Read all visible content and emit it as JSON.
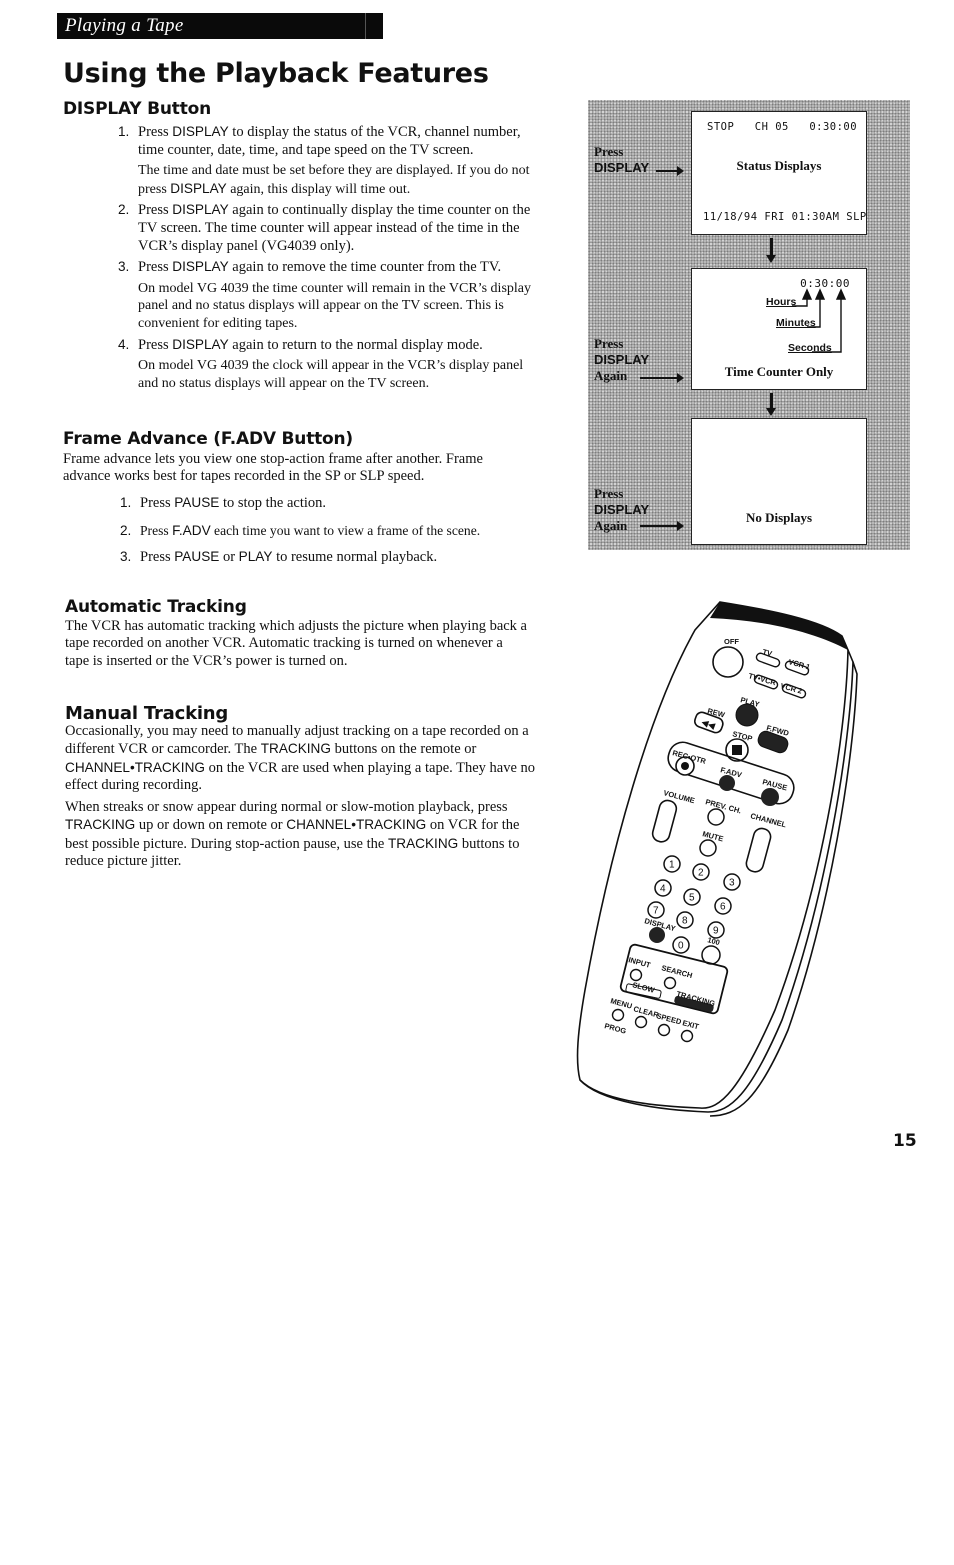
{
  "header": {
    "section_tab": "Playing a Tape"
  },
  "page": {
    "title": "Using the Playback Features",
    "page_number": "15"
  },
  "display_button": {
    "heading": "DISPLAY Button",
    "steps": [
      {
        "num": "1.",
        "pre": "Press ",
        "kw": "DISPLAY",
        "post": " to display the status of the VCR, channel number, time counter, date, time, and tape speed on the TV screen.",
        "note_pre": "The time and date must be set before they are displayed.  If you do not press ",
        "note_kw": "DISPLAY",
        "note_post": " again, this display will time out."
      },
      {
        "num": "2.",
        "pre": "Press ",
        "kw": "DISPLAY",
        "post": " again to continually display the time counter on the TV screen.  The time counter will appear instead of the time in the VCR’s display panel (VG4039 only).",
        "note_pre": "",
        "note_kw": "",
        "note_post": ""
      },
      {
        "num": "3.",
        "pre": "Press ",
        "kw": "DISPLAY",
        "post": " again to remove the time counter from the TV.",
        "note_pre": "On model VG 4039 the time counter will remain in the VCR’s display panel and no status displays will appear on the TV screen.  This is convenient for editing tapes.",
        "note_kw": "",
        "note_post": ""
      },
      {
        "num": "4.",
        "pre": "Press ",
        "kw": "DISPLAY",
        "post": " again to return to the normal display mode.",
        "note_pre": "On model VG 4039 the clock will appear in the VCR’s display panel and no status displays will appear on the TV screen.",
        "note_kw": "",
        "note_post": ""
      }
    ]
  },
  "frame_advance": {
    "heading": "Frame Advance (F.ADV Button)",
    "intro": "Frame advance lets you view one stop-action frame after another.  Frame advance works best for tapes recorded in the SP or SLP speed.",
    "steps": [
      {
        "num": "1.",
        "pre": "Press ",
        "kw": "PAUSE",
        "post": " to stop the action."
      },
      {
        "num": "2.",
        "pre": "Press ",
        "kw": "F.ADV",
        "post": " each time you want to view a frame of the scene."
      },
      {
        "num": "3.",
        "pre": "Press ",
        "kw": "PAUSE",
        "mid": "  or ",
        "kw2": "PLAY",
        "post": " to resume normal playback."
      }
    ]
  },
  "automatic_tracking": {
    "heading": "Automatic Tracking",
    "body": "The VCR has automatic tracking which adjusts the picture when playing back a tape recorded on another VCR.  Automatic tracking is turned on whenever a tape is inserted or the VCR’s power is turned on."
  },
  "manual_tracking": {
    "heading": "Manual Tracking",
    "p1_a": "Occasionally, you may need to manually adjust tracking on a tape recorded on a different VCR or camcorder.  The ",
    "p1_kw1": "TRACKING",
    "p1_b": " buttons on the remote or ",
    "p1_kw2": "CHANNEL•TRACKING",
    "p1_c": " on the VCR are used when playing a tape.  They have no effect during recording.",
    "p2_a": "When streaks or snow appear during normal or slow-motion playback, press ",
    "p2_kw1": "TRACKING",
    "p2_b": " up or down on remote or ",
    "p2_kw2": "CHANNEL•TRACKING",
    "p2_c": " on VCR for the best possible picture.  During stop-action pause, use the ",
    "p2_kw3": "TRACKING",
    "p2_d": " buttons to reduce picture jitter."
  },
  "diagram": {
    "screens": [
      {
        "top_line": "STOP   CH 05   0:30:00",
        "caption": "Status Displays",
        "bottom_line": "11/18/94 FRI 01:30AM SLP",
        "press_line1": "Press",
        "press_line2": "DISPLAY",
        "press_line3": ""
      },
      {
        "counter": "0:30:00",
        "labels": [
          "Hours",
          "Minutes",
          "Seconds"
        ],
        "caption": "Time Counter Only",
        "press_line1": "Press",
        "press_line2": "DISPLAY",
        "press_line3": "Again"
      },
      {
        "caption": "No Displays",
        "press_line1": "Press",
        "press_line2": "DISPLAY",
        "press_line3": "Again"
      }
    ]
  },
  "remote": {
    "labels": {
      "off": "OFF",
      "tv": "TV",
      "vcr1": "VCR 1",
      "tvvcr": "TV•VCR",
      "vcr2": "VCR 2",
      "play": "PLAY",
      "rew": "REW",
      "ffwd": "F.FWD",
      "stop": "STOP",
      "recotr": "REC•OTR",
      "fadv": "F.ADV",
      "pause": "PAUSE",
      "volume": "VOLUME",
      "prevch": "PREV. CH.",
      "channel": "CHANNEL",
      "mute": "MUTE",
      "display": "DISPLAY",
      "hundred": "100",
      "input": "INPUT",
      "search": "SEARCH",
      "slow": "SLOW",
      "tracking": "TRACKING",
      "menu": "MENU",
      "prog": "PROG",
      "clear": "CLEAR",
      "speed": "SPEED",
      "exit": "EXIT"
    },
    "digits": [
      "1",
      "2",
      "3",
      "4",
      "5",
      "6",
      "7",
      "8",
      "9",
      "0"
    ]
  }
}
